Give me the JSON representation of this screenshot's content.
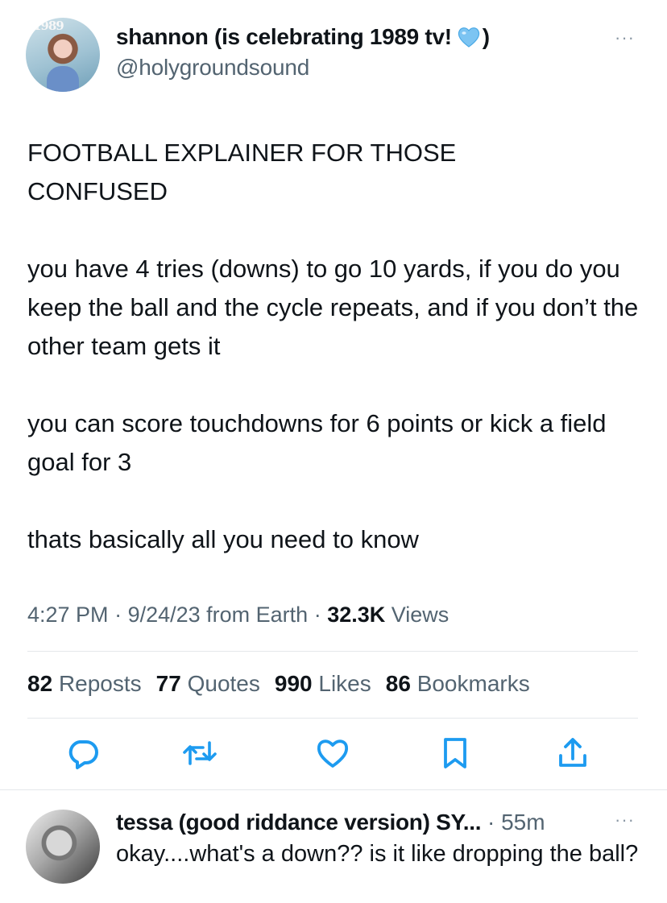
{
  "tweet": {
    "avatar_text": "1989",
    "display_name": "shannon (is celebrating 1989 tv!",
    "display_name_close": ")",
    "heart_emoji": "light-blue-heart",
    "handle": "@holygroundsound",
    "more_label": "···",
    "paragraphs": [
      "FOOTBALL EXPLAINER FOR THOSE CONFUSED",
      "you have 4 tries (downs) to go 10 yards, if you do you keep the ball and the cycle repeats, and if you don’t the other team gets it",
      "you can score touchdowns for 6 points or kick a field goal for 3",
      "thats basically all you need to know"
    ],
    "meta": {
      "time": "4:27 PM",
      "sep1": " · ",
      "date": "9/24/23",
      "source": " from Earth",
      "sep2": " · ",
      "views_count": "32.3K",
      "views_label": " Views"
    },
    "stats": {
      "reposts_count": "82",
      "reposts_label": "Reposts",
      "quotes_count": "77",
      "quotes_label": "Quotes",
      "likes_count": "990",
      "likes_label": "Likes",
      "bookmarks_count": "86",
      "bookmarks_label": "Bookmarks"
    },
    "actions": [
      "reply-icon",
      "repost-icon",
      "like-icon",
      "bookmark-icon",
      "share-icon"
    ],
    "accent_color": "#1d9bf0",
    "icon_color": "#1d9bf0"
  },
  "reply": {
    "display_name": "tessa (good riddance version) SY...",
    "time": " · 55m",
    "more_label": "···",
    "text": "okay....what's a down?? is it like dropping the ball?"
  }
}
